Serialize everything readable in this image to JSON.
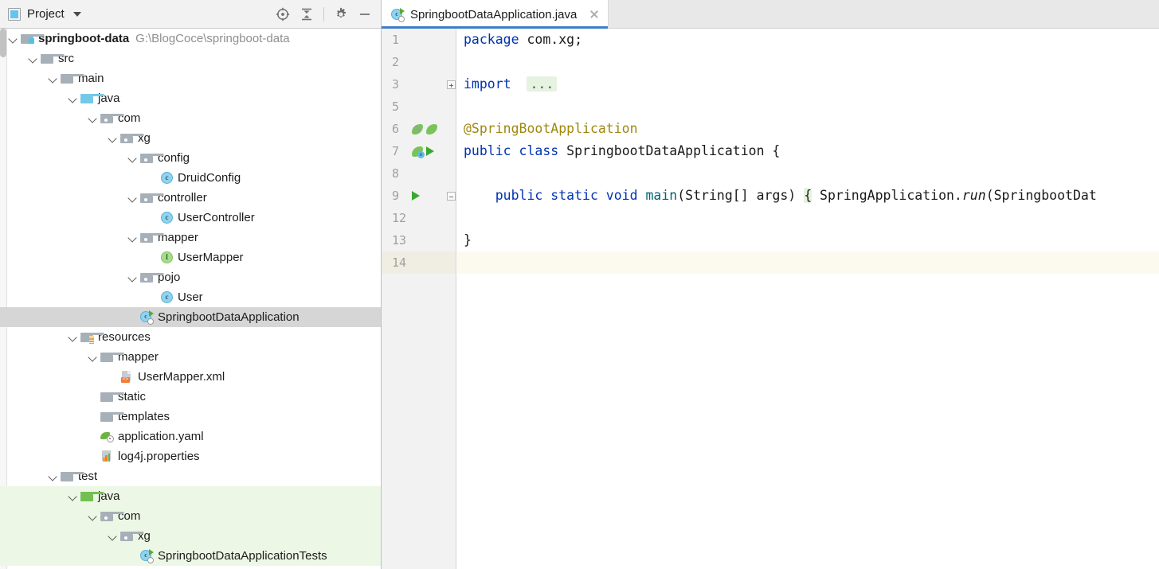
{
  "tool_window": {
    "title": "Project",
    "icon": "project-window-icon",
    "actions": [
      {
        "name": "scroll-from-source-button",
        "icon": "crosshair-target-icon"
      },
      {
        "name": "collapse-all-button",
        "icon": "collapse-all-icon"
      },
      {
        "name": "settings-button",
        "icon": "gear-icon"
      },
      {
        "name": "hide-button",
        "icon": "minimize-icon"
      }
    ]
  },
  "tree": [
    {
      "label": "springboot-data",
      "path": "G:\\BlogCoce\\springboot-data",
      "icon": "module-folder-icon",
      "depth": 0,
      "expanded": true,
      "bold": true
    },
    {
      "label": "src",
      "icon": "folder-icon",
      "depth": 1,
      "expanded": true
    },
    {
      "label": "main",
      "icon": "folder-icon",
      "depth": 2,
      "expanded": true
    },
    {
      "label": "java",
      "icon": "source-root-folder-icon",
      "depth": 3,
      "expanded": true
    },
    {
      "label": "com",
      "icon": "package-folder-icon",
      "depth": 4,
      "expanded": true
    },
    {
      "label": "xg",
      "icon": "package-folder-icon",
      "depth": 5,
      "expanded": true
    },
    {
      "label": "config",
      "icon": "package-folder-icon",
      "depth": 6,
      "expanded": true
    },
    {
      "label": "DruidConfig",
      "icon": "java-class-icon",
      "depth": 7
    },
    {
      "label": "controller",
      "icon": "package-folder-icon",
      "depth": 6,
      "expanded": true
    },
    {
      "label": "UserController",
      "icon": "java-class-icon",
      "depth": 7
    },
    {
      "label": "mapper",
      "icon": "package-folder-icon",
      "depth": 6,
      "expanded": true
    },
    {
      "label": "UserMapper",
      "icon": "java-interface-icon",
      "depth": 7
    },
    {
      "label": "pojo",
      "icon": "package-folder-icon",
      "depth": 6,
      "expanded": true
    },
    {
      "label": "User",
      "icon": "java-class-icon",
      "depth": 7
    },
    {
      "label": "SpringbootDataApplication",
      "icon": "spring-boot-runnable-class-icon",
      "depth": 6,
      "selected": true
    },
    {
      "label": "resources",
      "icon": "resources-folder-icon",
      "depth": 3,
      "expanded": true
    },
    {
      "label": "mapper",
      "icon": "folder-icon",
      "depth": 4,
      "expanded": true
    },
    {
      "label": "UserMapper.xml",
      "icon": "xml-file-icon",
      "depth": 5
    },
    {
      "label": "static",
      "icon": "folder-icon",
      "depth": 4
    },
    {
      "label": "templates",
      "icon": "folder-icon",
      "depth": 4
    },
    {
      "label": "application.yaml",
      "icon": "spring-yaml-file-icon",
      "depth": 4
    },
    {
      "label": "log4j.properties",
      "icon": "properties-file-icon",
      "depth": 4
    },
    {
      "label": "test",
      "icon": "folder-icon",
      "depth": 2,
      "expanded": true
    },
    {
      "label": "java",
      "icon": "test-source-root-folder-icon",
      "depth": 3,
      "expanded": true,
      "test": true
    },
    {
      "label": "com",
      "icon": "package-folder-icon",
      "depth": 4,
      "expanded": true,
      "test": true
    },
    {
      "label": "xg",
      "icon": "package-folder-icon",
      "depth": 5,
      "expanded": true,
      "test": true
    },
    {
      "label": "SpringbootDataApplicationTests",
      "icon": "spring-boot-runnable-class-icon",
      "depth": 6,
      "test": true
    }
  ],
  "editor": {
    "tab": {
      "label": "SpringbootDataApplication.java",
      "icon": "spring-boot-runnable-class-icon",
      "close_icon": "close-icon",
      "active": true
    },
    "lines": [
      {
        "num": "1",
        "segments": [
          {
            "t": "package",
            "c": "kw"
          },
          {
            "t": " com.xg;",
            "c": ""
          }
        ]
      },
      {
        "num": "2",
        "segments": []
      },
      {
        "num": "3",
        "segments": [
          {
            "t": "import",
            "c": "kw"
          },
          {
            "t": "  ",
            "c": ""
          },
          {
            "t": "...",
            "c": "fold"
          }
        ],
        "fold_marker": "plus"
      },
      {
        "num": "5",
        "segments": []
      },
      {
        "num": "6",
        "segments": [
          {
            "t": "@SpringBootApplication",
            "c": "anno"
          }
        ],
        "gutter": [
          "bean-check-icon",
          "bean-icon"
        ]
      },
      {
        "num": "7",
        "segments": [
          {
            "t": "public class",
            "c": "kw"
          },
          {
            "t": " SpringbootDataApplication {",
            "c": ""
          }
        ],
        "gutter": [
          "bean-e-icon",
          "run-icon"
        ]
      },
      {
        "num": "8",
        "segments": []
      },
      {
        "num": "9",
        "segments": [
          {
            "t": "    public static void ",
            "c": "kw"
          },
          {
            "t": "main",
            "c": "mth"
          },
          {
            "t": "(String[] args) ",
            "c": ""
          },
          {
            "t": "{",
            "c": "foldbrace"
          },
          {
            "t": " SpringApplication.",
            "c": ""
          },
          {
            "t": "run",
            "c": "stat"
          },
          {
            "t": "(SpringbootDat",
            "c": ""
          }
        ],
        "gutter": [
          "run-icon"
        ],
        "fold_marker": "minus"
      },
      {
        "num": "12",
        "segments": []
      },
      {
        "num": "13",
        "segments": [
          {
            "t": "}",
            "c": ""
          }
        ]
      },
      {
        "num": "14",
        "segments": [],
        "caret": true
      }
    ]
  },
  "colors": {
    "keyword": "#0033b3",
    "annotation": "#9e880d",
    "method": "#00627a",
    "selection": "#d6d6d6",
    "test_scope": "#edf7e5",
    "caret_line": "#fcfaef",
    "tab_accent": "#3d7ec4"
  }
}
